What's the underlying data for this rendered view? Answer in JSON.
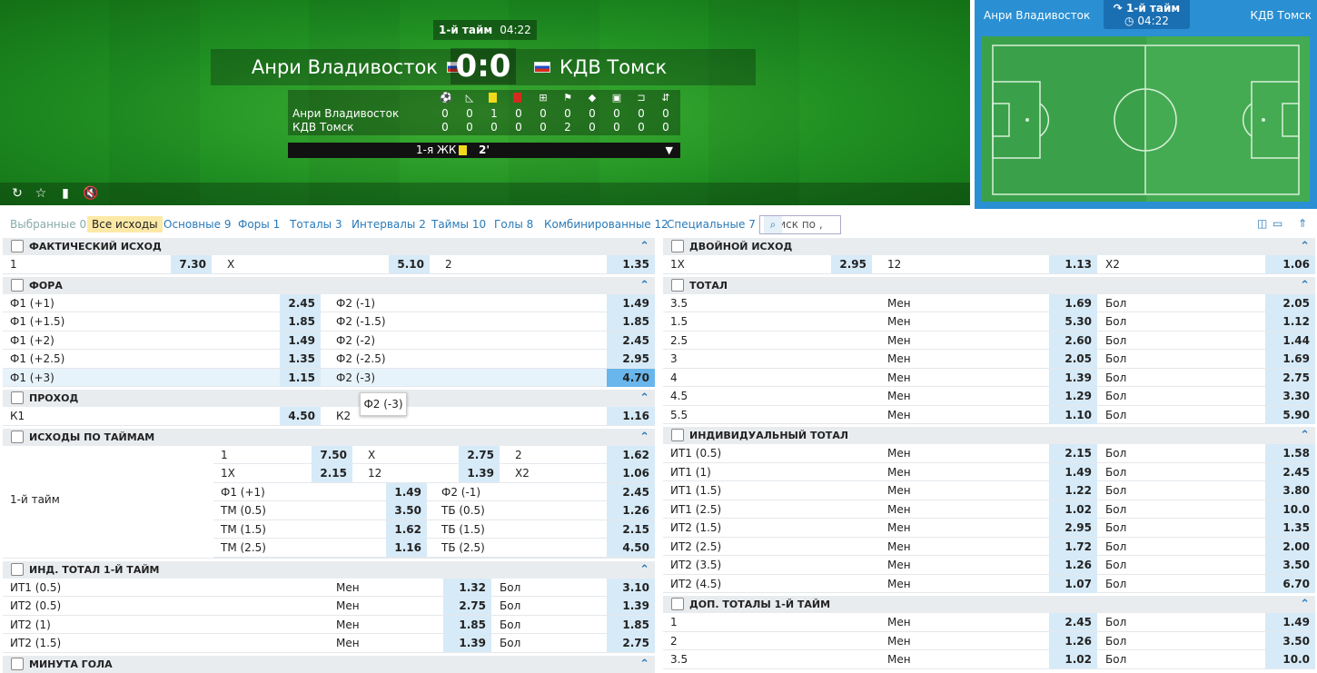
{
  "match": {
    "period": "1-й тайм",
    "clock": "04:22",
    "team1": "Анри Владивосток",
    "team2": "КДВ Томск",
    "score": "0:0"
  },
  "stats": {
    "icons": [
      "ball-icon",
      "corner-icon",
      "yellow-card-icon",
      "red-card-icon",
      "penalty-icon",
      "offside-icon",
      "free-kick-icon",
      "throw-in-icon",
      "goal-kick-icon",
      "substitution-icon"
    ],
    "rows": [
      {
        "team": "Анри Владивосток",
        "values": [
          "0",
          "0",
          "1",
          "0",
          "0",
          "0",
          "0",
          "0",
          "0",
          "0"
        ]
      },
      {
        "team": "КДВ Томск",
        "values": [
          "0",
          "0",
          "0",
          "0",
          "0",
          "2",
          "0",
          "0",
          "0",
          "0"
        ]
      }
    ]
  },
  "event": {
    "label": "1-я ЖК",
    "minute": "2'"
  },
  "pitch": {
    "team1": "Анри Владивосток",
    "team2": "КДВ Томск",
    "period": "1-й тайм",
    "clock": "04:22"
  },
  "tabs": [
    "Выбранные 0",
    "Все исходы",
    "Основные 9",
    "Форы 1",
    "Тоталы 3",
    "Интервалы 2",
    "Таймы 10",
    "Голы 8",
    "Комбинированные 12",
    "Специальные 7"
  ],
  "search": {
    "placeholder": "Поиск по ,"
  },
  "tooltip": "Ф2 (-3)",
  "left": {
    "outcome": {
      "title": "ФАКТИЧЕСКИЙ ИСХОД",
      "row": [
        "1",
        "7.30",
        "X",
        "5.10",
        "2",
        "1.35"
      ]
    },
    "handicap": {
      "title": "ФОРА",
      "rows": [
        [
          "Ф1 (+1)",
          "2.45",
          "Ф2 (-1)",
          "1.49"
        ],
        [
          "Ф1 (+1.5)",
          "1.85",
          "Ф2 (-1.5)",
          "1.85"
        ],
        [
          "Ф1 (+2)",
          "1.49",
          "Ф2 (-2)",
          "2.45"
        ],
        [
          "Ф1 (+2.5)",
          "1.35",
          "Ф2 (-2.5)",
          "2.95"
        ],
        [
          "Ф1 (+3)",
          "1.15",
          "Ф2 (-3)",
          "4.70"
        ]
      ]
    },
    "pass": {
      "title": "ПРОХОД",
      "row": [
        "К1",
        "4.50",
        "К2",
        "1.16"
      ]
    },
    "halves": {
      "title": "ИСХОДЫ ПО ТАЙМАМ",
      "label": "1-й тайм",
      "three": [
        [
          "1",
          "7.50",
          "X",
          "2.75",
          "2",
          "1.62"
        ],
        [
          "1X",
          "2.15",
          "12",
          "1.39",
          "X2",
          "1.06"
        ]
      ],
      "two": [
        [
          "Ф1 (+1)",
          "1.49",
          "Ф2 (-1)",
          "2.45"
        ],
        [
          "ТМ (0.5)",
          "3.50",
          "ТБ (0.5)",
          "1.26"
        ],
        [
          "ТМ (1.5)",
          "1.62",
          "ТБ (1.5)",
          "2.15"
        ],
        [
          "ТМ (2.5)",
          "1.16",
          "ТБ (2.5)",
          "4.50"
        ]
      ]
    },
    "indTotal": {
      "title": "ИНД. ТОТАЛ 1-Й ТАЙМ",
      "rows": [
        [
          "ИТ1 (0.5)",
          "Мен",
          "1.32",
          "Бол",
          "3.10"
        ],
        [
          "ИТ2 (0.5)",
          "Мен",
          "2.75",
          "Бол",
          "1.39"
        ],
        [
          "ИТ2 (1)",
          "Мен",
          "1.85",
          "Бол",
          "1.85"
        ],
        [
          "ИТ2 (1.5)",
          "Мен",
          "1.39",
          "Бол",
          "2.75"
        ]
      ]
    },
    "goalMinute": {
      "title": "МИНУТА ГОЛА"
    }
  },
  "right": {
    "double": {
      "title": "ДВОЙНОЙ ИСХОД",
      "row": [
        "1X",
        "2.95",
        "12",
        "1.13",
        "X2",
        "1.06"
      ]
    },
    "total": {
      "title": "ТОТАЛ",
      "rows": [
        [
          "3.5",
          "Мен",
          "1.69",
          "Бол",
          "2.05"
        ],
        [
          "1.5",
          "Мен",
          "5.30",
          "Бол",
          "1.12"
        ],
        [
          "2.5",
          "Мен",
          "2.60",
          "Бол",
          "1.44"
        ],
        [
          "3",
          "Мен",
          "2.05",
          "Бол",
          "1.69"
        ],
        [
          "4",
          "Мен",
          "1.39",
          "Бол",
          "2.75"
        ],
        [
          "4.5",
          "Мен",
          "1.29",
          "Бол",
          "3.30"
        ],
        [
          "5.5",
          "Мен",
          "1.10",
          "Бол",
          "5.90"
        ]
      ]
    },
    "indTotal": {
      "title": "ИНДИВИДУАЛЬНЫЙ ТОТАЛ",
      "rows": [
        [
          "ИТ1 (0.5)",
          "Мен",
          "2.15",
          "Бол",
          "1.58"
        ],
        [
          "ИТ1 (1)",
          "Мен",
          "1.49",
          "Бол",
          "2.45"
        ],
        [
          "ИТ1 (1.5)",
          "Мен",
          "1.22",
          "Бол",
          "3.80"
        ],
        [
          "ИТ1 (2.5)",
          "Мен",
          "1.02",
          "Бол",
          "10.0"
        ],
        [
          "ИТ2 (1.5)",
          "Мен",
          "2.95",
          "Бол",
          "1.35"
        ],
        [
          "ИТ2 (2.5)",
          "Мен",
          "1.72",
          "Бол",
          "2.00"
        ],
        [
          "ИТ2 (3.5)",
          "Мен",
          "1.26",
          "Бол",
          "3.50"
        ],
        [
          "ИТ2 (4.5)",
          "Мен",
          "1.07",
          "Бол",
          "6.70"
        ]
      ]
    },
    "addTotal": {
      "title": "ДОП. ТОТАЛЫ 1-Й ТАЙМ",
      "rows": [
        [
          "1",
          "Мен",
          "2.45",
          "Бол",
          "1.49"
        ],
        [
          "2",
          "Мен",
          "1.26",
          "Бол",
          "3.50"
        ],
        [
          "3.5",
          "Мен",
          "1.02",
          "Бол",
          "10.0"
        ]
      ]
    }
  }
}
